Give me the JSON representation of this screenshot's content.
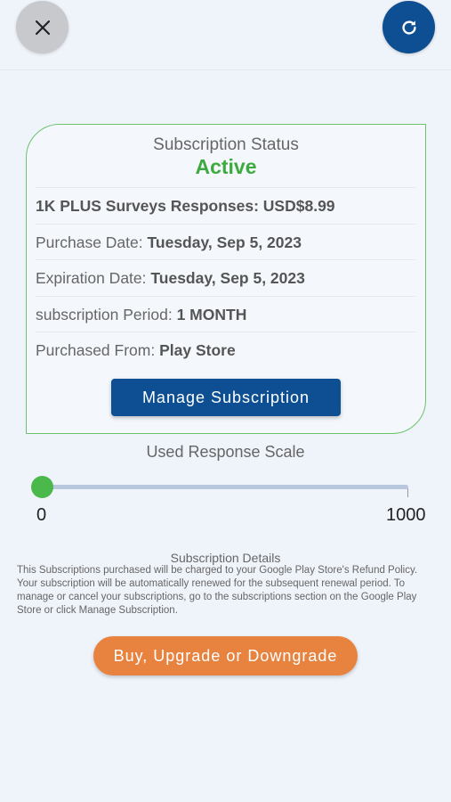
{
  "header": {
    "close_icon": "close-icon",
    "refresh_icon": "refresh-icon"
  },
  "subscription": {
    "status_title": "Subscription Status",
    "status_value": "Active",
    "plan": "1K PLUS Surveys Responses: USD$8.99",
    "purchase_date_label": "Purchase Date:",
    "purchase_date_value": "Tuesday, Sep 5, 2023",
    "expiration_date_label": "Expiration Date:",
    "expiration_date_value": "Tuesday, Sep 5, 2023",
    "period_label": "subscription Period:",
    "period_value": "1 MONTH",
    "purchased_from_label": "Purchased From:",
    "purchased_from_value": "Play Store",
    "manage_button": "Manage Subscription"
  },
  "usage_scale": {
    "title": "Used Response Scale",
    "min_label": "0",
    "max_label": "1000",
    "value_fraction": 0
  },
  "details": {
    "title": "Subscription Details",
    "text": "This Subscriptions purchased will be charged to your Google Play Store's Refund Policy. Your subscription will be automatically renewed for the subsequent renewal period.  To manage or cancel your subscriptions, go to the subscriptions section on the Google Play Store or click Manage Subscription."
  },
  "buy_button": "Buy, Upgrade or Downgrade",
  "colors": {
    "background": "#eff3fa",
    "primary_blue": "#0d4f92",
    "active_green": "#3daa3d",
    "card_border": "#6bc46b",
    "buy_orange": "#e8823f",
    "close_grey": "#c7c9cc"
  }
}
